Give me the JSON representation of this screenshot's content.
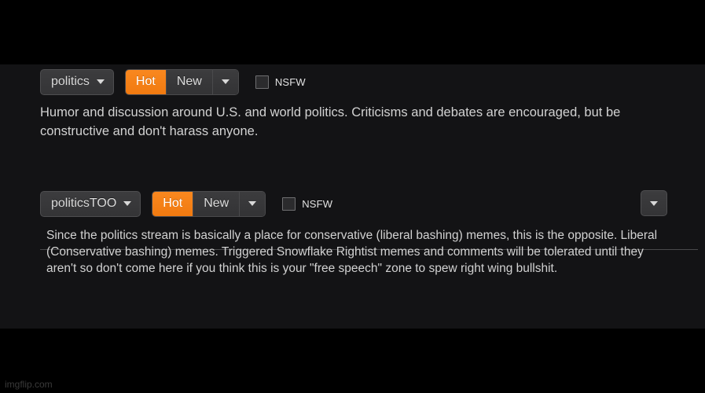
{
  "watermark": "imgflip.com",
  "accent_color": "#f9881f",
  "panel_bg": "#131315",
  "streams": [
    {
      "name": "politics",
      "select_caret_icon": "chevron-down-icon",
      "sort_options": [
        "Hot",
        "New"
      ],
      "sort_active": "Hot",
      "sort_more_icon": "chevron-down-icon",
      "nsfw_label": "NSFW",
      "nsfw_checked": false,
      "description": "Humor and discussion around U.S. and world politics. Criticisms and debates are encouraged, but be constructive and don't harass anyone.",
      "has_right_dropdown": false
    },
    {
      "name": "politicsTOO",
      "select_caret_icon": "chevron-down-icon",
      "sort_options": [
        "Hot",
        "New"
      ],
      "sort_active": "Hot",
      "sort_more_icon": "chevron-down-icon",
      "nsfw_label": "NSFW",
      "nsfw_checked": false,
      "description": "Since the politics stream is basically a place for conservative (liberal bashing) memes, this is the opposite. Liberal (Conservative bashing) memes. Triggered Snowflake Rightist memes and comments will be tolerated until they aren't so don't come here if you think this is your \"free speech\" zone to spew right wing bullshit.",
      "has_right_dropdown": true,
      "right_dropdown_icon": "chevron-down-icon"
    }
  ]
}
